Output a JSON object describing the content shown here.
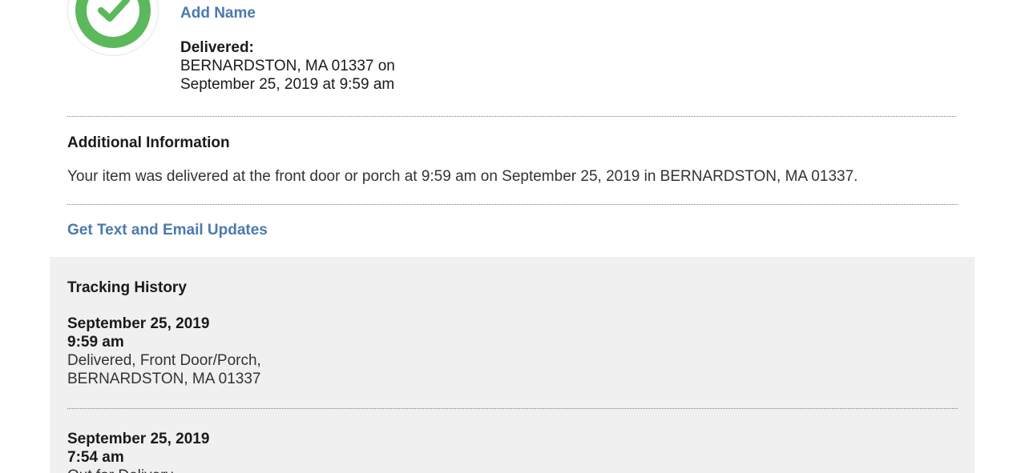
{
  "status": {
    "icon": "check-circle-icon",
    "color": "#5cb85c",
    "add_name_label": "Add Name",
    "delivered_label": "Delivered:",
    "delivered_location": "BERNARDSTON, MA 01337 on",
    "delivered_datetime": "September 25, 2019 at 9:59 am"
  },
  "additional": {
    "title": "Additional Information",
    "text": "Your item was delivered at the front door or porch at 9:59 am on September 25, 2019 in BERNARDSTON, MA 01337."
  },
  "updates": {
    "link_label": "Get Text and Email Updates"
  },
  "history": {
    "title": "Tracking History",
    "events": [
      {
        "date": "September 25, 2019",
        "time": "9:59 am",
        "status": "Delivered, Front Door/Porch,",
        "location": "BERNARDSTON, MA 01337"
      },
      {
        "date": "September 25, 2019",
        "time": "7:54 am",
        "status": "Out for Delivery"
      }
    ]
  },
  "colors": {
    "link": "#4a7ab0",
    "panel_background": "#f0f0f0",
    "success": "#5cb85c"
  }
}
